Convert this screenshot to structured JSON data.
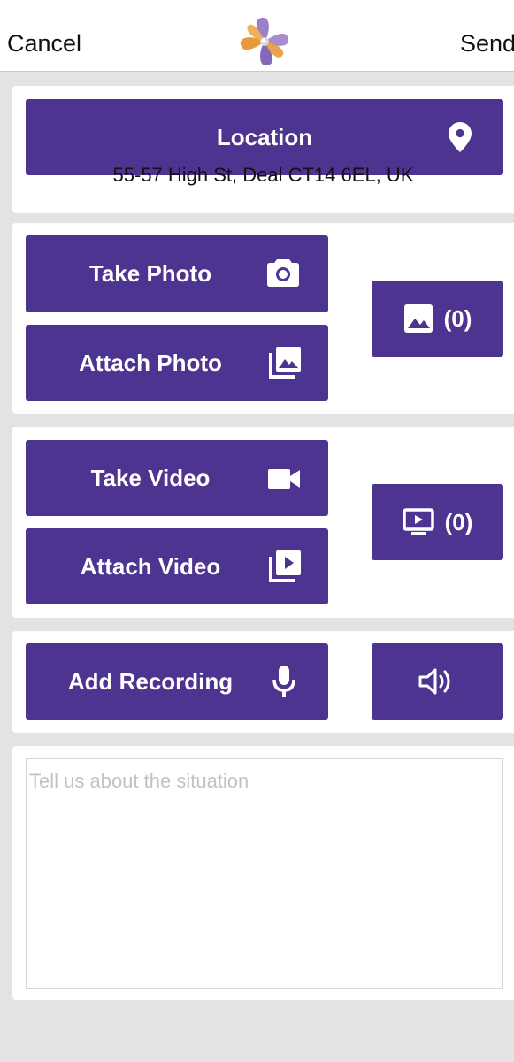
{
  "nav": {
    "cancel_label": "Cancel",
    "send_label": "Send",
    "logo_icon": "pinwheel-logo"
  },
  "location": {
    "button_label": "Location",
    "icon": "map-pin-icon",
    "address": "55-57 High St, Deal CT14 6EL, UK"
  },
  "photo": {
    "take_label": "Take Photo",
    "take_icon": "camera-icon",
    "attach_label": "Attach Photo",
    "attach_icon": "photo-library-icon",
    "gallery_icon": "image-icon",
    "count": "(0)"
  },
  "video": {
    "take_label": "Take Video",
    "take_icon": "video-camera-icon",
    "attach_label": "Attach Video",
    "attach_icon": "video-library-icon",
    "gallery_icon": "video-screen-icon",
    "count": "(0)"
  },
  "recording": {
    "add_label": "Add Recording",
    "mic_icon": "microphone-icon",
    "play_icon": "speaker-icon"
  },
  "description": {
    "placeholder": "Tell us about the situation",
    "value": ""
  },
  "colors": {
    "button": "#4d3490",
    "background": "#e4e3e4",
    "card": "#ffffff"
  }
}
